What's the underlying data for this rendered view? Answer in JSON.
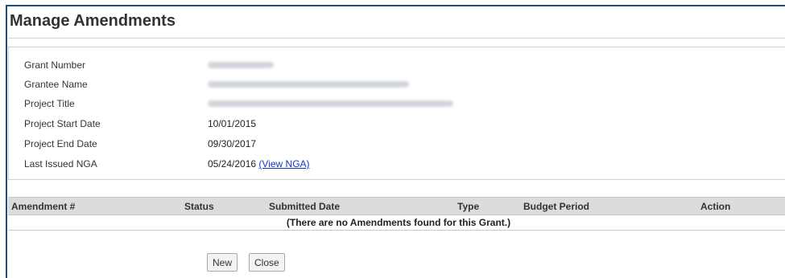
{
  "page": {
    "title": "Manage Amendments"
  },
  "grant_info": {
    "grant_number_label": "Grant Number",
    "grantee_name_label": "Grantee Name",
    "project_title_label": "Project Title",
    "project_start_label": "Project Start Date",
    "project_start_value": "10/01/2015",
    "project_end_label": "Project End Date",
    "project_end_value": "09/30/2017",
    "last_nga_label": "Last Issued NGA",
    "last_nga_value": "05/24/2016",
    "view_nga_link": "(View NGA)"
  },
  "amendments_table": {
    "columns": [
      "Amendment #",
      "Status",
      "Submitted Date",
      "Type",
      "Budget Period",
      "Action"
    ],
    "empty_message": "(There are no Amendments found for this Grant.)"
  },
  "buttons": {
    "new_label": "New",
    "close_label": "Close"
  },
  "colors": {
    "frame_border": "#1f4e79",
    "header_bg": "#dcdcdc",
    "link": "#1a33cc"
  }
}
